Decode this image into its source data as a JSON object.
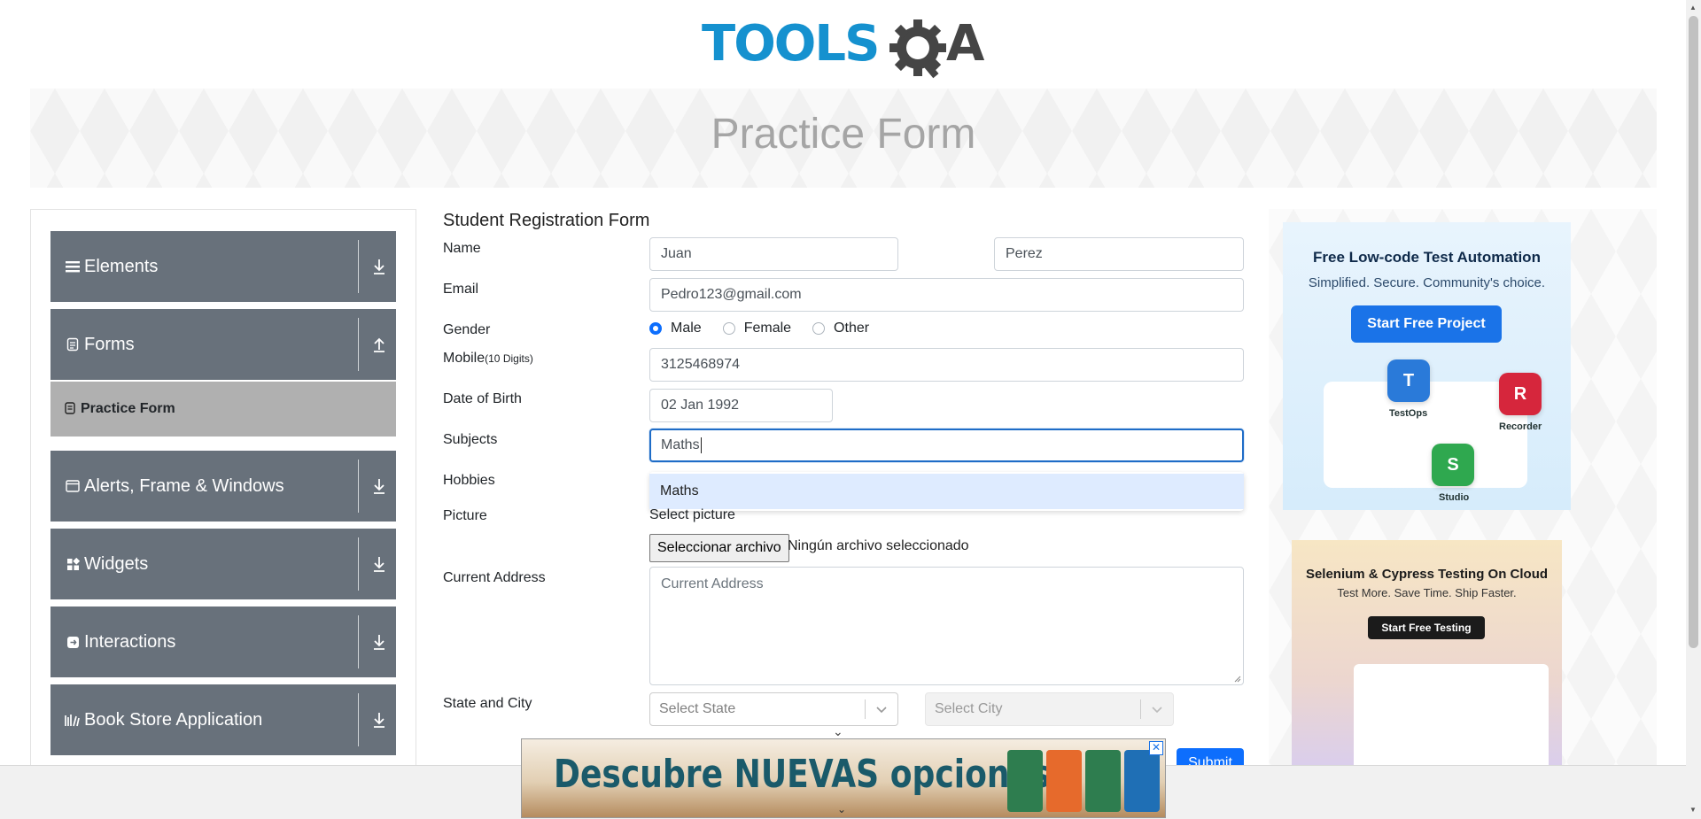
{
  "header": {
    "logo_tools": "TOOLS",
    "logo_a": "A"
  },
  "banner": {
    "title": "Practice Form"
  },
  "sidebar": {
    "groups": [
      {
        "label": "Elements",
        "icon": "menu-icon"
      },
      {
        "label": "Forms",
        "icon": "document-icon",
        "expanded": true,
        "subitems": [
          {
            "label": "Practice Form",
            "icon": "form-icon"
          }
        ]
      },
      {
        "label": "Alerts, Frame & Windows",
        "icon": "window-icon"
      },
      {
        "label": "Widgets",
        "icon": "widgets-icon"
      },
      {
        "label": "Interactions",
        "icon": "interactions-icon"
      },
      {
        "label": "Book Store Application",
        "icon": "books-icon"
      }
    ]
  },
  "form": {
    "title": "Student Registration Form",
    "labels": {
      "name": "Name",
      "email": "Email",
      "gender": "Gender",
      "mobile": "Mobile",
      "mobile_hint": "(10 Digits)",
      "dob": "Date of Birth",
      "subjects": "Subjects",
      "hobbies": "Hobbies",
      "picture": "Picture",
      "address": "Current Address",
      "state_city": "State and City"
    },
    "first_name": "Juan",
    "last_name": "Perez",
    "email": "Pedro123@gmail.com",
    "gender_options": [
      "Male",
      "Female",
      "Other"
    ],
    "gender_selected": "Male",
    "mobile": "3125468974",
    "dob": "02 Jan 1992",
    "subjects_input": "Maths",
    "subjects_suggestion": "Maths",
    "select_picture": "Select picture",
    "file_button": "Seleccionar archivo",
    "file_status": "Ningún archivo seleccionado",
    "address_placeholder": "Current Address",
    "state_placeholder": "Select State",
    "city_placeholder": "Select City",
    "submit": "Submit"
  },
  "ads": {
    "ad1": {
      "heading": "Free Low-code Test Automation",
      "sub": "Simplified. Secure. Community's choice.",
      "button": "Start Free Project",
      "tiles": [
        "TestOps",
        "Recorder",
        "Studio"
      ]
    },
    "ad2": {
      "heading": "Selenium & Cypress Testing On Cloud",
      "sub": "Test More. Save Time. Ship Faster.",
      "button": "Start Free Testing"
    },
    "bottom": {
      "text": "Descubre NUEVAS opciones",
      "close": "✕"
    }
  },
  "colors": {
    "sidebar_bg": "#68717b",
    "active_sub_bg": "#b0b0b0",
    "primary": "#0d6efd",
    "logo_blue": "#1591cf"
  }
}
